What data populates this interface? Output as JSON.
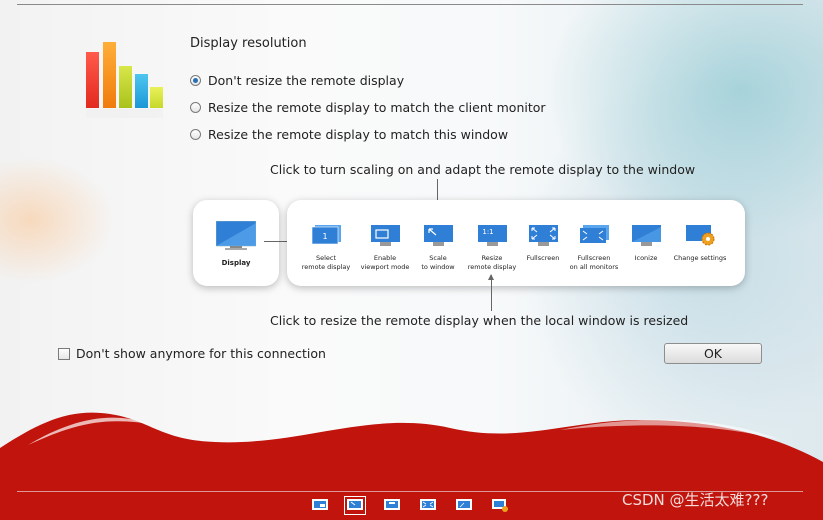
{
  "section_title": "Display resolution",
  "options": [
    {
      "label": "Don't resize the remote display",
      "selected": true
    },
    {
      "label": "Resize the remote display to match the client monitor",
      "selected": false
    },
    {
      "label": "Resize the remote display to match this window",
      "selected": false
    }
  ],
  "hint_top": "Click to turn scaling on and adapt the remote display to the window",
  "hint_bottom": "Click to resize the remote display when the local window is resized",
  "display_card": {
    "label": "Display"
  },
  "toolbar_items": [
    {
      "line1": "Select",
      "line2": "remote display",
      "icon": "monitor-1-icon"
    },
    {
      "line1": "Enable",
      "line2": "viewport mode",
      "icon": "viewport-icon"
    },
    {
      "line1": "Scale",
      "line2": "to window",
      "icon": "scale-icon"
    },
    {
      "line1": "Resize",
      "line2": "remote display",
      "icon": "resize-1-1-icon"
    },
    {
      "line1": "Fullscreen",
      "line2": "",
      "icon": "fullscreen-icon"
    },
    {
      "line1": "Fullscreen",
      "line2": "on all monitors",
      "icon": "fullscreen-all-icon"
    },
    {
      "line1": "Iconize",
      "line2": "",
      "icon": "iconize-icon"
    },
    {
      "line1": "Change settings",
      "line2": "",
      "icon": "settings-gear-icon"
    }
  ],
  "dont_show": {
    "label": "Don't show anymore for this connection",
    "checked": false
  },
  "ok_label": "OK",
  "watermark": "CSDN @生活太难???",
  "colors": {
    "accent": "#2a6fb3",
    "banner": "#c0140c",
    "monitor": "#3d8fe0"
  }
}
